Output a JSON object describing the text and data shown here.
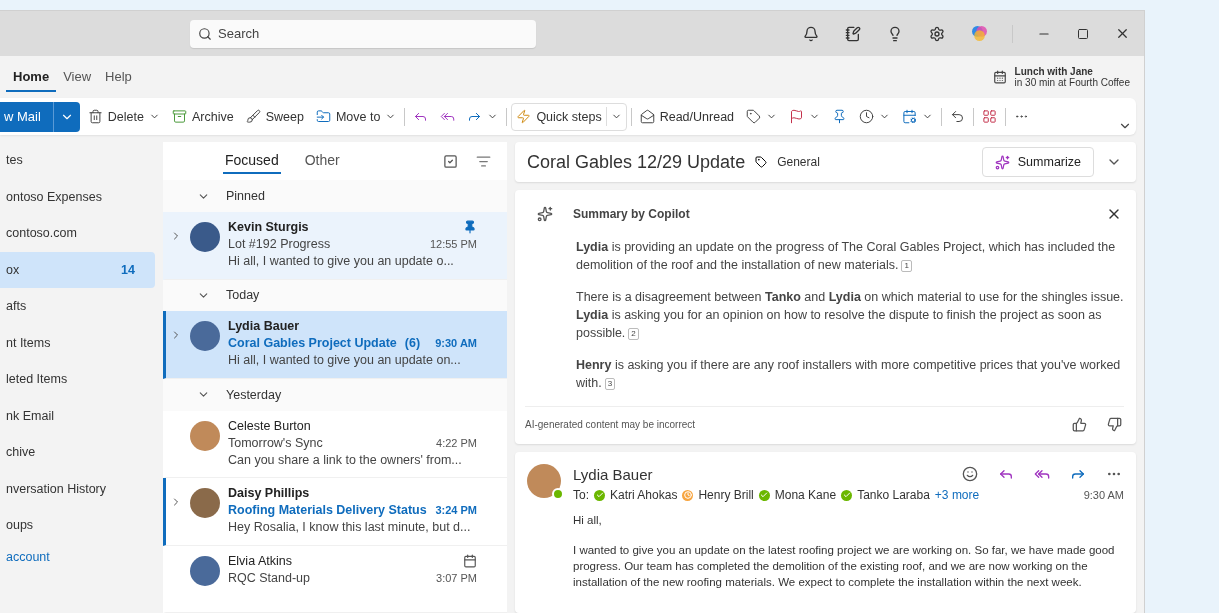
{
  "titlebar": {
    "search": {
      "placeholder": "Search"
    }
  },
  "ribbon_tabs": [
    {
      "label": "Home",
      "selected": true
    },
    {
      "label": "View",
      "selected": false
    },
    {
      "label": "Help",
      "selected": false
    }
  ],
  "reminder": {
    "title": "Lunch with Jane",
    "detail": "in 30 min at Fourth Coffee"
  },
  "toolbar": {
    "new_mail": "w Mail",
    "items": [
      {
        "kind": "button",
        "label": "Delete",
        "dropdown": true
      },
      {
        "kind": "button",
        "label": "Archive",
        "dropdown": false
      },
      {
        "kind": "button",
        "label": "Sweep",
        "dropdown": false
      },
      {
        "kind": "button",
        "label": "Move to",
        "dropdown": true
      },
      {
        "kind": "divider"
      },
      {
        "kind": "button",
        "dropdown": false
      },
      {
        "kind": "button",
        "dropdown": false
      },
      {
        "kind": "button",
        "dropdown": true
      },
      {
        "kind": "divider"
      },
      {
        "kind": "split",
        "label": "Quick steps"
      },
      {
        "kind": "divider"
      },
      {
        "kind": "button",
        "label": "Read/Unread",
        "dropdown": false
      },
      {
        "kind": "button",
        "dropdown": true
      },
      {
        "kind": "button",
        "dropdown": true
      },
      {
        "kind": "button",
        "dropdown": false
      },
      {
        "kind": "button",
        "dropdown": true
      },
      {
        "kind": "button",
        "dropdown": true
      },
      {
        "kind": "divider"
      },
      {
        "kind": "button",
        "dropdown": false
      },
      {
        "kind": "divider"
      },
      {
        "kind": "button",
        "dropdown": false
      },
      {
        "kind": "divider"
      },
      {
        "kind": "button",
        "dropdown": false
      }
    ]
  },
  "sidebar": {
    "items": [
      {
        "label": "tes",
        "selected": false
      },
      {
        "label": "ontoso Expenses",
        "selected": false
      },
      {
        "label": "contoso.com",
        "selected": false
      },
      {
        "label": "ox",
        "count": "14",
        "selected": true
      },
      {
        "label": "afts",
        "selected": false
      },
      {
        "label": "nt Items",
        "selected": false
      },
      {
        "label": "leted Items",
        "selected": false
      },
      {
        "label": "nk Email",
        "selected": false
      },
      {
        "label": "chive",
        "selected": false
      },
      {
        "label": "nversation History",
        "selected": false
      },
      {
        "label": "oups",
        "selected": false
      }
    ],
    "link": "account"
  },
  "mail_list": {
    "tabs": [
      {
        "label": "Focused",
        "selected": true
      },
      {
        "label": "Other",
        "selected": false
      }
    ],
    "groups": [
      {
        "label": "Pinned",
        "messages": [
          {
            "sender": "Kevin Sturgis",
            "subject": "Lot #192 Progress",
            "time": "12:55 PM",
            "preview": "Hi all, I wanted to give you an update o...",
            "unread": false,
            "selected": false,
            "pinned": true,
            "thread": true
          }
        ]
      },
      {
        "label": "Today",
        "messages": [
          {
            "sender": "Lydia Bauer",
            "subject": "Coral Gables Project Update",
            "count": "(6)",
            "time": "9:30 AM",
            "preview": "Hi all, I wanted to give you an update on...",
            "unread": true,
            "selected": true,
            "pinned": false,
            "thread": true
          }
        ]
      },
      {
        "label": "Yesterday",
        "messages": [
          {
            "sender": "Celeste Burton",
            "subject": "Tomorrow's Sync",
            "time": "4:22 PM",
            "preview": "Can you share a link to the owners' from...",
            "unread": false,
            "selected": false,
            "pinned": false,
            "thread": false
          },
          {
            "sender": "Daisy Phillips",
            "subject": "Roofing Materials Delivery Status",
            "time": "3:24 PM",
            "preview": "Hey Rosalia, I know this last minute, but d...",
            "unread": true,
            "selected": false,
            "pinned": false,
            "thread": true
          },
          {
            "sender": "Elvia Atkins",
            "subject": "RQC Stand-up",
            "time": "3:07 PM",
            "unread": false,
            "selected": false,
            "pinned": false,
            "thread": false,
            "meeting": true
          }
        ]
      }
    ]
  },
  "reading_pane": {
    "subject": "Coral Gables 12/29 Update",
    "tag": "General",
    "summarize": "Summarize",
    "summary": {
      "title": "Summary by Copilot",
      "paragraphs": [
        {
          "text": "**Lydia** is providing an update on the progress of The Coral Gables Project, which has included the demolition of the roof and the installation of new materials.",
          "ref": "1"
        },
        {
          "text": "There is a disagreement between **Tanko** and **Lydia** on which material to use for the shingles issue. **Lydia** is asking you for an opinion on how to resolve the dispute to finish the project as soon as possible.",
          "ref": "2"
        },
        {
          "text": "**Henry** is asking you if there are any roof installers with more competitive prices that you've worked with.",
          "ref": "3"
        }
      ],
      "disclaimer": "AI-generated content may be incorrect"
    },
    "message": {
      "sender": "Lydia Bauer",
      "to_label": "To:",
      "recipients": [
        {
          "name": "Katri Ahokas",
          "away": false
        },
        {
          "name": "Henry Brill",
          "away": true
        },
        {
          "name": "Mona Kane",
          "away": false
        },
        {
          "name": "Tanko Laraba",
          "away": false
        }
      ],
      "more": "+3 more",
      "time": "9:30 AM",
      "body": [
        "Hi all,",
        "I wanted to give you an update on the latest roofing project we are working on. So far, we have made good progress. Our team has completed the demolition of the existing roof, and we are now working on the installation of the new roofing materials. We expect to complete the installation within the next week."
      ]
    }
  }
}
